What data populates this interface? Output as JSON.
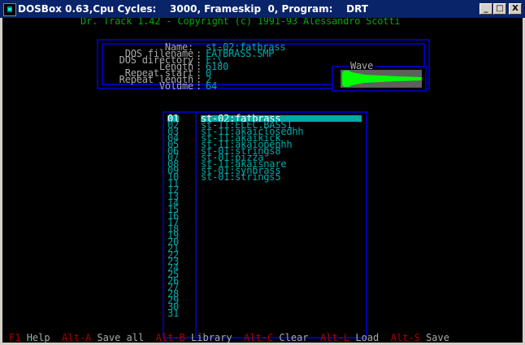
{
  "window": {
    "title": "DOSBox 0.63,Cpu Cycles:    3000, Frameskip  0, Program:    DRT",
    "buttons": {
      "minimize": "_",
      "maximize": "□",
      "close": "X"
    }
  },
  "header": {
    "copyright": "Dr. Track 1.42 - Copyright (c) 1991-93 Alessandro Scotti"
  },
  "sample_info": {
    "fields": [
      {
        "label": "Name:",
        "value": "st-02:fatbrass"
      },
      {
        "label": "DOS filename",
        "value": "FATBRASS.SMP"
      },
      {
        "label": "DOS directory",
        "value": "F:\\"
      },
      {
        "label": "Length",
        "value": "6180"
      },
      {
        "label": "Repeat start",
        "value": "0"
      },
      {
        "label": "Repeat length",
        "value": "2"
      },
      {
        "label": "Volume",
        "value": "64"
      }
    ],
    "wave_label": "Wave"
  },
  "sample_list": {
    "numbers": [
      "01",
      "02",
      "03",
      "04",
      "05",
      "06",
      "07",
      "08",
      "09",
      "10",
      "11",
      "12",
      "13",
      "14",
      "15",
      "16",
      "17",
      "18",
      "19",
      "20",
      "21",
      "22",
      "23",
      "24",
      "25",
      "26",
      "27",
      "28",
      "29",
      "30",
      "31"
    ],
    "names": [
      "st-02:fatbrass",
      "st-11:ELEC.BASS1",
      "st-11:akaiclosedhh",
      "st-11:akaikick",
      "st-11:akaiopenhh",
      "st-01:strings8",
      "st-01:pizza",
      "st-11:akaisnare",
      "st-01:synbrass",
      "st-01:strings5"
    ],
    "selected_index": 0
  },
  "statusbar": {
    "items": [
      {
        "key": "F1",
        "desc": "Help"
      },
      {
        "key": "Alt-A",
        "desc": "Save all"
      },
      {
        "key": "Alt-B",
        "desc": "Library"
      },
      {
        "key": "Alt-C",
        "desc": "Clear"
      },
      {
        "key": "Alt-L",
        "desc": "Load"
      },
      {
        "key": "Alt-S",
        "desc": "Save"
      }
    ]
  },
  "colors": {
    "title_bg": "#0a246a",
    "crt_bg": "#000000",
    "cyan": "#00aaaa",
    "grey": "#aaaaaa",
    "blue_frame": "#0000aa",
    "green": "#00aa00",
    "red_key": "#aa0000",
    "wave_green": "#00ff00"
  }
}
